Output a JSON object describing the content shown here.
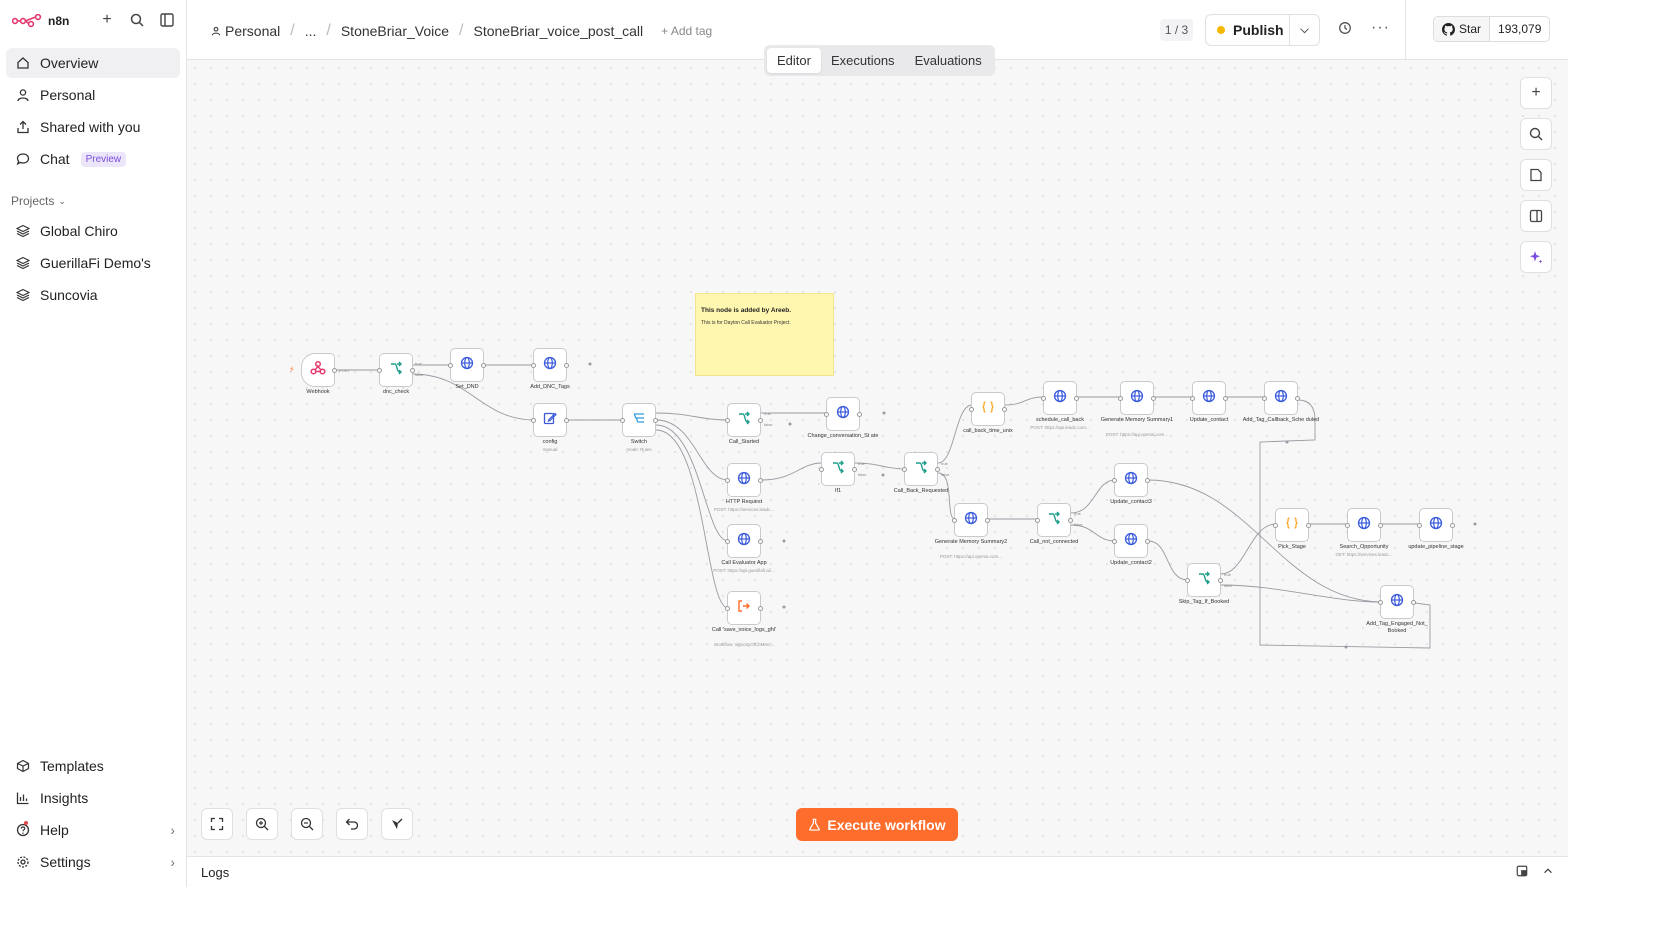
{
  "brand": {
    "name": "n8n"
  },
  "sidebar": {
    "items": [
      {
        "label": "Overview",
        "icon": "home-icon"
      },
      {
        "label": "Personal",
        "icon": "user-icon"
      },
      {
        "label": "Shared with you",
        "icon": "share-icon"
      },
      {
        "label": "Chat",
        "icon": "chat-icon",
        "badge": "Preview"
      }
    ],
    "projects_label": "Projects",
    "projects": [
      {
        "label": "Global Chiro"
      },
      {
        "label": "GuerillaFi Demo's"
      },
      {
        "label": "Suncovia"
      }
    ],
    "bottom": [
      {
        "label": "Templates"
      },
      {
        "label": "Insights"
      },
      {
        "label": "Help"
      },
      {
        "label": "Settings"
      }
    ]
  },
  "header": {
    "breadcrumb": [
      "Personal",
      "...",
      "StoneBriar_Voice",
      "StoneBriar_voice_post_call"
    ],
    "add_tag": "+ Add tag",
    "version_counter": "1 / 3",
    "publish_label": "Publish",
    "github_star": "Star",
    "github_count": "193,079"
  },
  "tabs": [
    "Editor",
    "Executions",
    "Evaluations"
  ],
  "canvas": {
    "execute_label": "Execute workflow",
    "sticky": {
      "title": "This node is added by Areeb.",
      "body": "This is for Dayton Call Evaluator Project."
    },
    "nodes": [
      {
        "label": "Webhook",
        "icon": "webhook-icon"
      },
      {
        "label": "dnc_check",
        "icon": "if-icon"
      },
      {
        "label": "Set_DND",
        "icon": "globe-icon"
      },
      {
        "label": "Add_DNC_Tags",
        "icon": "globe-icon"
      },
      {
        "label": "config",
        "sub": "manual",
        "icon": "edit-icon"
      },
      {
        "label": "Switch",
        "sub": "mode: Rules",
        "icon": "switch-icon"
      },
      {
        "label": "Call_Started",
        "icon": "if-icon"
      },
      {
        "label": "Change_conversation_St ate",
        "icon": "globe-icon"
      },
      {
        "label": "HTTP Request",
        "sub": "POST: https://services.leadc...",
        "icon": "globe-icon"
      },
      {
        "label": "If1",
        "icon": "if-icon"
      },
      {
        "label": "Call_Back_Requested",
        "icon": "if-icon"
      },
      {
        "label": "Call Evaluator App",
        "sub": "POST: https://api.guerillafi.ai/...",
        "icon": "globe-icon"
      },
      {
        "label": "Call 'save_voice_logs_ghl'",
        "sub": "Workflow: signoityOfCbMtec...",
        "icon": "subworkflow-icon"
      },
      {
        "label": "call_back_time_unix",
        "icon": "code-icon"
      },
      {
        "label": "schedule_call_back",
        "sub": "POST: https://api.leadc.com...",
        "icon": "globe-icon"
      },
      {
        "label": "Generate Memory Summary1",
        "sub": "POST: https://api.openai.com...",
        "icon": "globe-icon"
      },
      {
        "label": "Update_contact",
        "icon": "globe-icon"
      },
      {
        "label": "Add_Tag_Callback_Sche duled",
        "icon": "globe-icon"
      },
      {
        "label": "Generate Memory Summary2",
        "sub": "POST: https://api.openai.com...",
        "icon": "globe-icon"
      },
      {
        "label": "Call_not_connected",
        "icon": "if-icon"
      },
      {
        "label": "Update_contact3",
        "icon": "globe-icon"
      },
      {
        "label": "Update_contact2",
        "icon": "globe-icon"
      },
      {
        "label": "Skip_Tag_If_Booked",
        "icon": "if-icon"
      },
      {
        "label": "Pick_Stage",
        "icon": "code-icon"
      },
      {
        "label": "Search_Opportunity",
        "sub": "GET: https://services.leadc...",
        "icon": "globe-icon"
      },
      {
        "label": "update_pipeline_stage",
        "icon": "globe-icon"
      },
      {
        "label": "Add_Tag_Engaged_Not_ Booked",
        "icon": "globe-icon"
      }
    ],
    "port_labels": {
      "post": "POST",
      "true": "true",
      "false": "false"
    }
  },
  "logs": {
    "label": "Logs"
  },
  "colors": {
    "accent": "#ff6d2d",
    "if": "#1e9e8a",
    "globe": "#3b5bdb",
    "code": "#f5a623",
    "webhook": "#e5386d",
    "purple": "#7c4ddc"
  }
}
